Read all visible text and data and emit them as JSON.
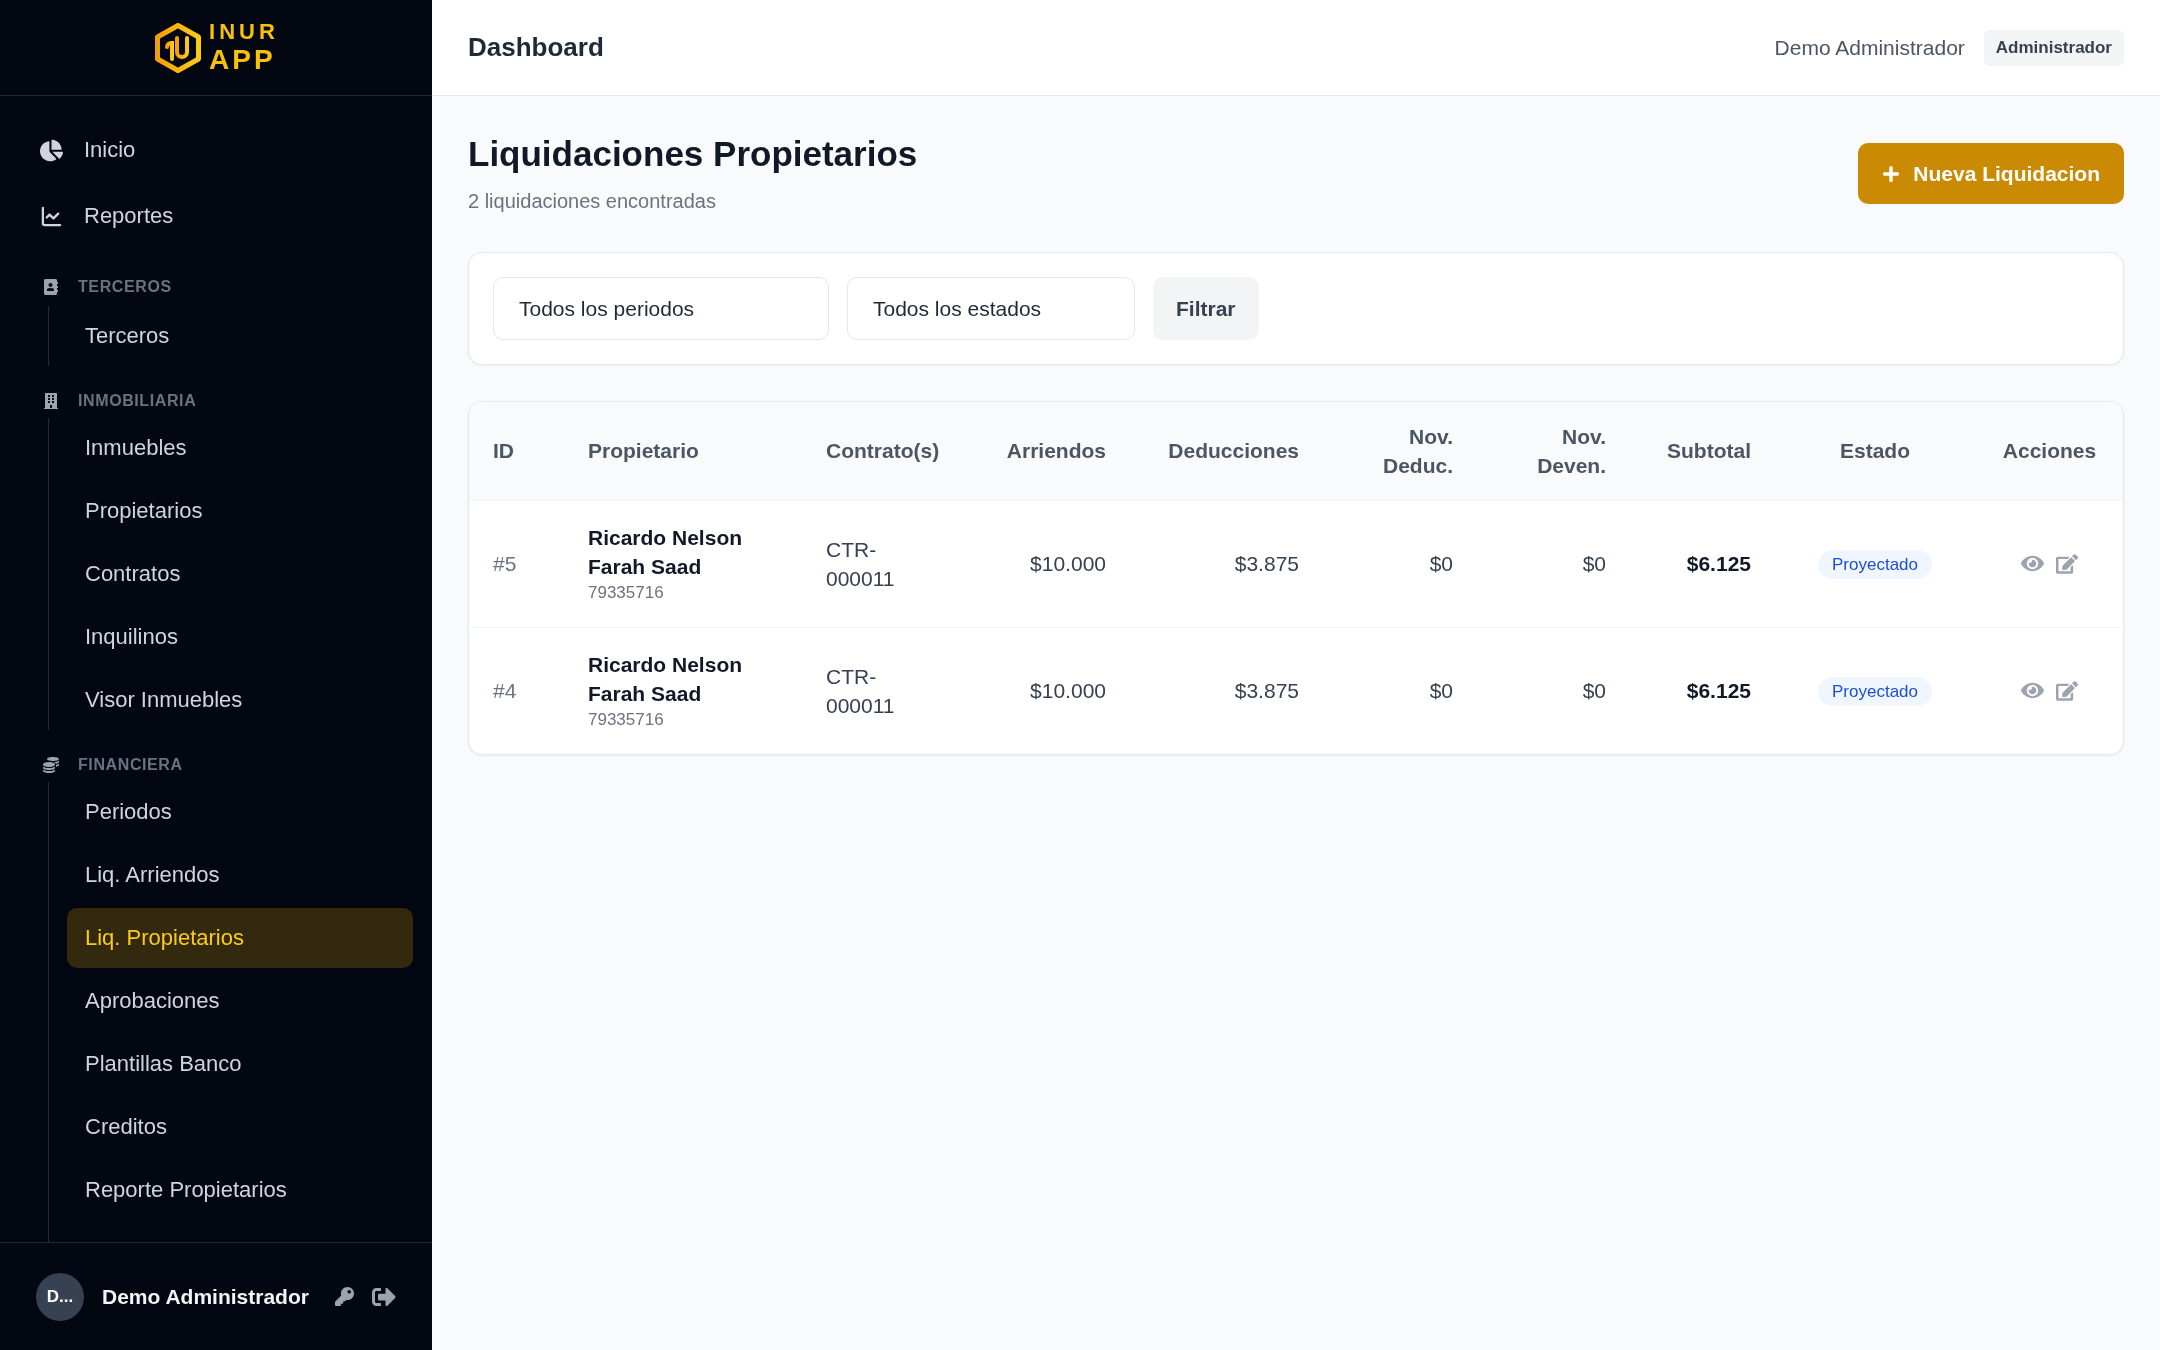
{
  "sidebar": {
    "logo": {
      "line_1": "INUR",
      "line_2": "APP"
    },
    "items": [
      {
        "label": "Inicio",
        "selected": false
      },
      {
        "label": "Reportes",
        "selected": false
      }
    ],
    "sections": [
      {
        "title": "TERCEROS",
        "items": [
          {
            "label": "Terceros",
            "selected": false
          }
        ]
      },
      {
        "title": "INMOBILIARIA",
        "items": [
          {
            "label": "Inmuebles",
            "selected": false
          },
          {
            "label": "Propietarios",
            "selected": false
          },
          {
            "label": "Contratos",
            "selected": false
          },
          {
            "label": "Inquilinos",
            "selected": false
          },
          {
            "label": "Visor Inmuebles",
            "selected": false
          }
        ]
      },
      {
        "title": "FINANCIERA",
        "items": [
          {
            "label": "Periodos",
            "selected": false
          },
          {
            "label": "Liq. Arriendos",
            "selected": false
          },
          {
            "label": "Liq. Propietarios",
            "selected": true
          },
          {
            "label": "Aprobaciones",
            "selected": false
          },
          {
            "label": "Plantillas Banco",
            "selected": false
          },
          {
            "label": "Creditos",
            "selected": false
          },
          {
            "label": "Reporte Propietarios",
            "selected": false
          }
        ]
      }
    ],
    "user": {
      "initials": "D...",
      "name": "Demo Administrador"
    }
  },
  "header": {
    "title": "Dashboard",
    "user_name": "Demo Administrador",
    "role_badge": "Administrador"
  },
  "page": {
    "title": "Liquidaciones Propietarios",
    "subtitle": "2 liquidaciones encontradas",
    "primary_button": "Nueva Liquidacion"
  },
  "filters": {
    "period_select": "Todos los periodos",
    "status_select": "Todos los estados",
    "filter_button": "Filtrar"
  },
  "table": {
    "columns": [
      "ID",
      "Propietario",
      "Contrato(s)",
      "Arriendos",
      "Deducciones",
      "Nov. Deduc.",
      "Nov. Deven.",
      "Subtotal",
      "Estado",
      "Acciones"
    ],
    "rows": [
      {
        "id": "#5",
        "owner_name": "Ricardo Nelson Farah Saad",
        "owner_document": "79335716",
        "contracts": "CTR-000011",
        "arriendos": "$10.000",
        "deducciones": "$3.875",
        "nov_deduc": "$0",
        "nov_deven": "$0",
        "subtotal": "$6.125",
        "status": "Proyectado"
      },
      {
        "id": "#4",
        "owner_name": "Ricardo Nelson Farah Saad",
        "owner_document": "79335716",
        "contracts": "CTR-000011",
        "arriendos": "$10.000",
        "deducciones": "$3.875",
        "nov_deduc": "$0",
        "nov_deven": "$0",
        "subtotal": "$6.125",
        "status": "Proyectado"
      }
    ]
  }
}
